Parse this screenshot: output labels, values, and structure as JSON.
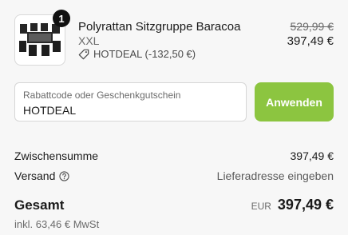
{
  "product": {
    "quantity": "1",
    "title": "Polyrattan Sitzgruppe Baracoa",
    "variant": "XXL",
    "discount_text": "HOTDEAL (-132,50 €)",
    "old_price": "529,99 €",
    "price": "397,49 €"
  },
  "coupon": {
    "label": "Rabattcode oder Geschenkgutschein",
    "value": "HOTDEAL",
    "apply_label": "Anwenden"
  },
  "summary": {
    "subtotal_label": "Zwischensumme",
    "subtotal_value": "397,49 €",
    "shipping_label": "Versand",
    "shipping_value": "Lieferadresse eingeben",
    "total_label": "Gesamt",
    "total_currency": "EUR",
    "total_value": "397,49 €",
    "tax_note": "inkl. 63,46 € MwSt"
  },
  "colors": {
    "accent": "#8cc540",
    "badge": "#111111"
  }
}
